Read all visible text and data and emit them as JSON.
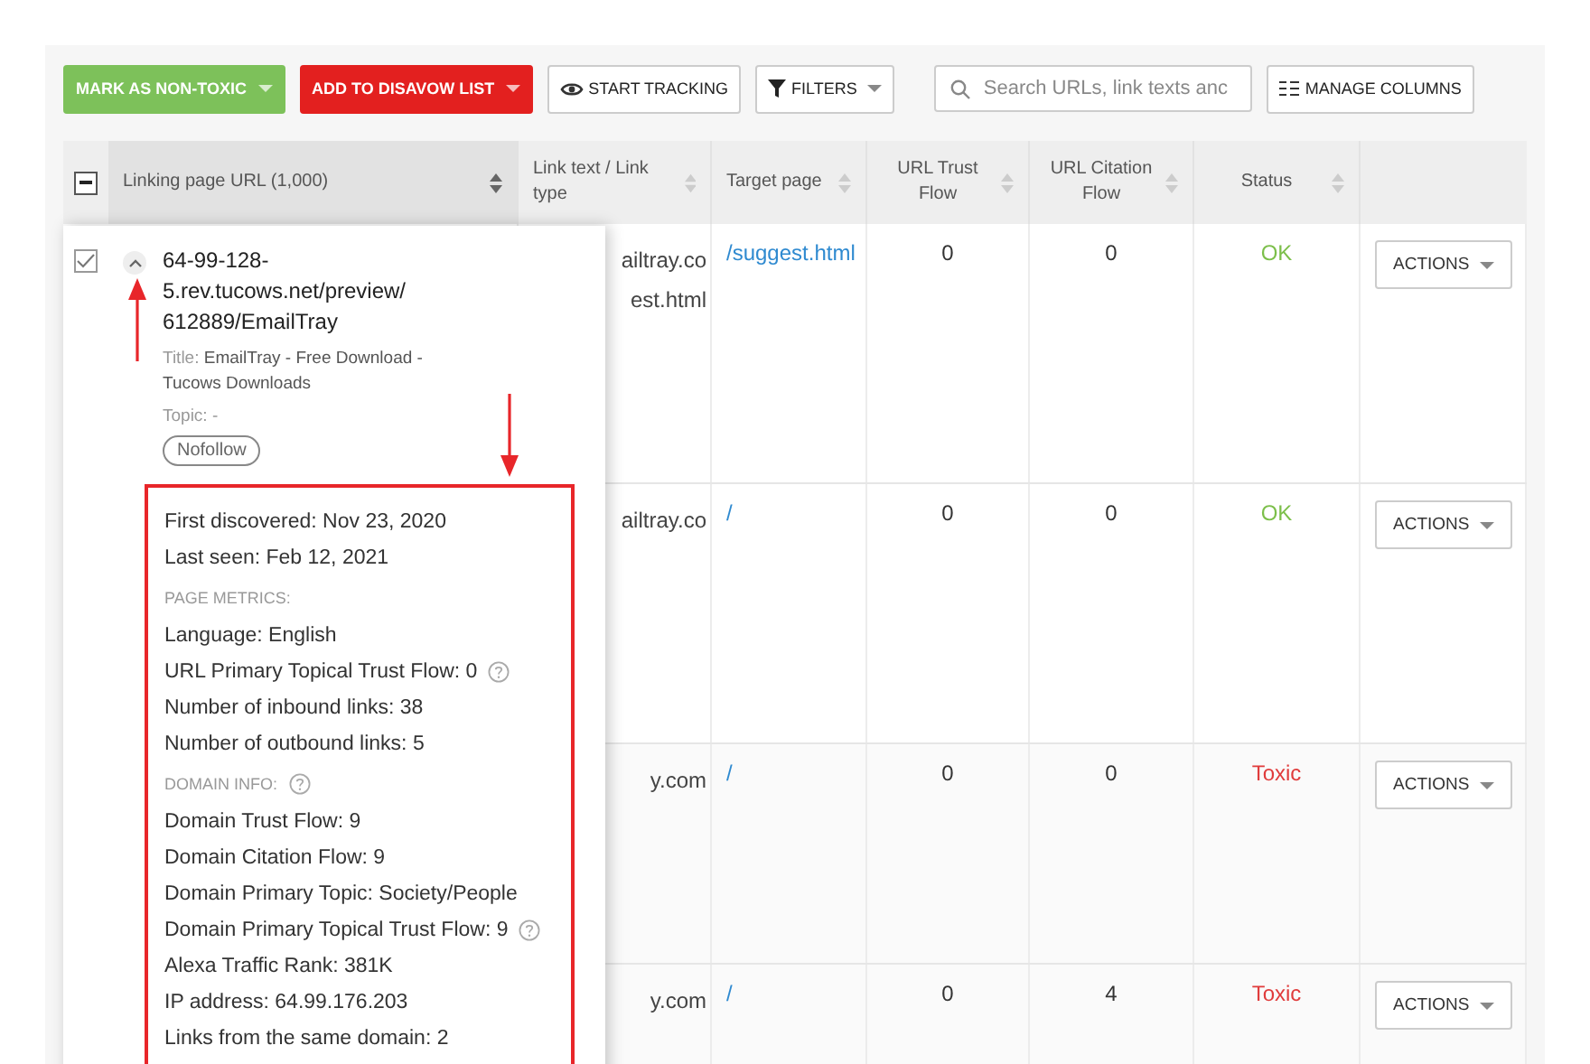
{
  "toolbar": {
    "buttons": [
      {
        "label": "MARK AS NON-TOXIC",
        "kind": "success",
        "dropdown": true
      },
      {
        "label": "ADD TO DISAVOW LIST",
        "kind": "danger",
        "dropdown": true
      },
      {
        "label": "START TRACKING",
        "kind": "tracking",
        "dropdown": false
      },
      {
        "label": "FILTERS",
        "kind": "filter",
        "dropdown": true
      }
    ],
    "search": {
      "placeholder": "Search URLs, link texts anc"
    },
    "columns_button": {
      "label": "MANAGE COLUMNS"
    }
  },
  "table": {
    "select_all": {
      "indeterminate": true
    },
    "columns": [
      {
        "label": "Linking page URL (1,000)",
        "sorted": true
      },
      {
        "label": "Link text / Link type",
        "sorted": false
      },
      {
        "label": "Target page",
        "sorted": false
      },
      {
        "label": "URL Trust Flow",
        "sorted": false
      },
      {
        "label": "URL Citation Flow",
        "sorted": false
      },
      {
        "label": "Status",
        "sorted": false
      }
    ],
    "rows": [
      {
        "link_text": [
          "ailtray.co",
          "est.html"
        ],
        "target": "/suggest.html",
        "url_trust_flow": "0",
        "url_citation_flow": "0",
        "status": {
          "text": "OK",
          "color": "#7cbf4a"
        },
        "action": "ACTIONS"
      },
      {
        "link_text": [
          "ailtray.co"
        ],
        "target": "/",
        "url_trust_flow": "0",
        "url_citation_flow": "0",
        "status": {
          "text": "OK",
          "color": "#7cbf4a"
        },
        "action": "ACTIONS"
      },
      {
        "link_text": [
          "y.com"
        ],
        "target": "/",
        "url_trust_flow": "0",
        "url_citation_flow": "0",
        "status": {
          "text": "Toxic",
          "color": "#e03c3c"
        },
        "action": "ACTIONS"
      },
      {
        "link_text": [
          "y.com"
        ],
        "target": "/",
        "url_trust_flow": "0",
        "url_citation_flow": "4",
        "status": {
          "text": "Toxic",
          "color": "#e03c3c"
        },
        "action": "ACTIONS"
      }
    ]
  },
  "popup": {
    "checked": true,
    "expanded": true,
    "url_lines": [
      "64-99-128-",
      "5.rev.tucows.net/preview/",
      "612889/EmailTray"
    ],
    "title_label": "Title:",
    "title_value": "EmailTray - Free Download - Tucows Downloads",
    "topic": "Topic: -",
    "tag": "Nofollow",
    "details": [
      {
        "kind": "line",
        "text": "First discovered: Nov 23, 2020"
      },
      {
        "kind": "line",
        "text": "Last seen: Feb 12, 2021"
      },
      {
        "kind": "heading",
        "text": "PAGE METRICS:"
      },
      {
        "kind": "line",
        "text": "Language: English"
      },
      {
        "kind": "line_help",
        "text": "URL Primary Topical Trust Flow: 0"
      },
      {
        "kind": "line",
        "text": "Number of inbound links: 38"
      },
      {
        "kind": "line",
        "text": "Number of outbound links: 5"
      },
      {
        "kind": "heading_help",
        "text": "DOMAIN INFO:"
      },
      {
        "kind": "line",
        "text": "Domain Trust Flow: 9"
      },
      {
        "kind": "line",
        "text": "Domain Citation Flow: 9"
      },
      {
        "kind": "line",
        "text": "Domain Primary Topic:  Society/People"
      },
      {
        "kind": "line_help",
        "text": "Domain Primary Topical Trust  Flow: 9"
      },
      {
        "kind": "line",
        "text": "Alexa Traffic Rank: 381K"
      },
      {
        "kind": "line",
        "text": "IP address: 64.99.176.203"
      },
      {
        "kind": "line",
        "text": "Links from the same domain: 2"
      }
    ]
  }
}
